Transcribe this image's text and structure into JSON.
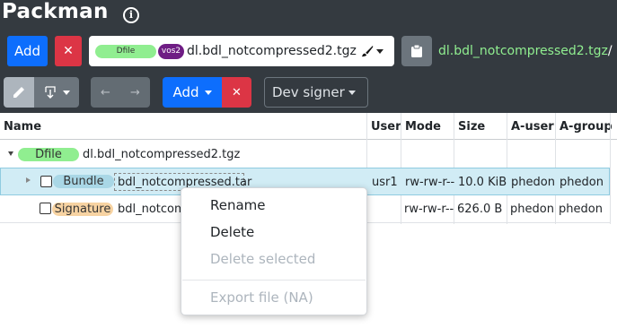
{
  "app": {
    "title": "Packman",
    "info_icon": "info-icon"
  },
  "toolbar1": {
    "add_label": "Add",
    "remove_label": "✕",
    "package_select": {
      "type_badge": "Dfile",
      "os_badge": "vos2",
      "name": "dl.bdl_notcompressed2.tgz",
      "icon": "brush-icon"
    },
    "clipboard_icon": "clipboard-icon",
    "path": "dl.bdl_notcompressed2.tgz",
    "path_sep": "/"
  },
  "toolbar2": {
    "edit_icon": "pencil-icon",
    "download_icon": "download-icon",
    "back_label": "←",
    "forward_label": "→",
    "add_label": "Add",
    "remove_label": "✕",
    "signer_label": "Dev signer"
  },
  "table": {
    "headers": [
      "Name",
      "User",
      "Mode",
      "Size",
      "A-user",
      "A-group"
    ],
    "root": {
      "badge": "Dfile",
      "name": "dl.bdl_notcompressed2.tgz"
    },
    "rows": [
      {
        "badge": "Bundle",
        "name": "bdl_notcompressed.tar",
        "user": "usr1",
        "mode": "rw-rw-r--",
        "size": "10.0 KiB",
        "auser": "phedon",
        "agroup": "phedon"
      },
      {
        "badge": "Signature",
        "name": "bdl_notcom",
        "user": "",
        "mode": "rw-rw-r--",
        "size": "626.0 B",
        "auser": "phedon",
        "agroup": "phedon"
      }
    ]
  },
  "context_menu": {
    "items": [
      "Rename",
      "Delete",
      "Delete selected",
      "Export file (NA)"
    ]
  },
  "colors": {
    "topbar": "#343a40",
    "primary": "#0d6efd",
    "danger": "#dc3545",
    "path": "#90ee90",
    "selected_row": "#d1ecf5"
  }
}
